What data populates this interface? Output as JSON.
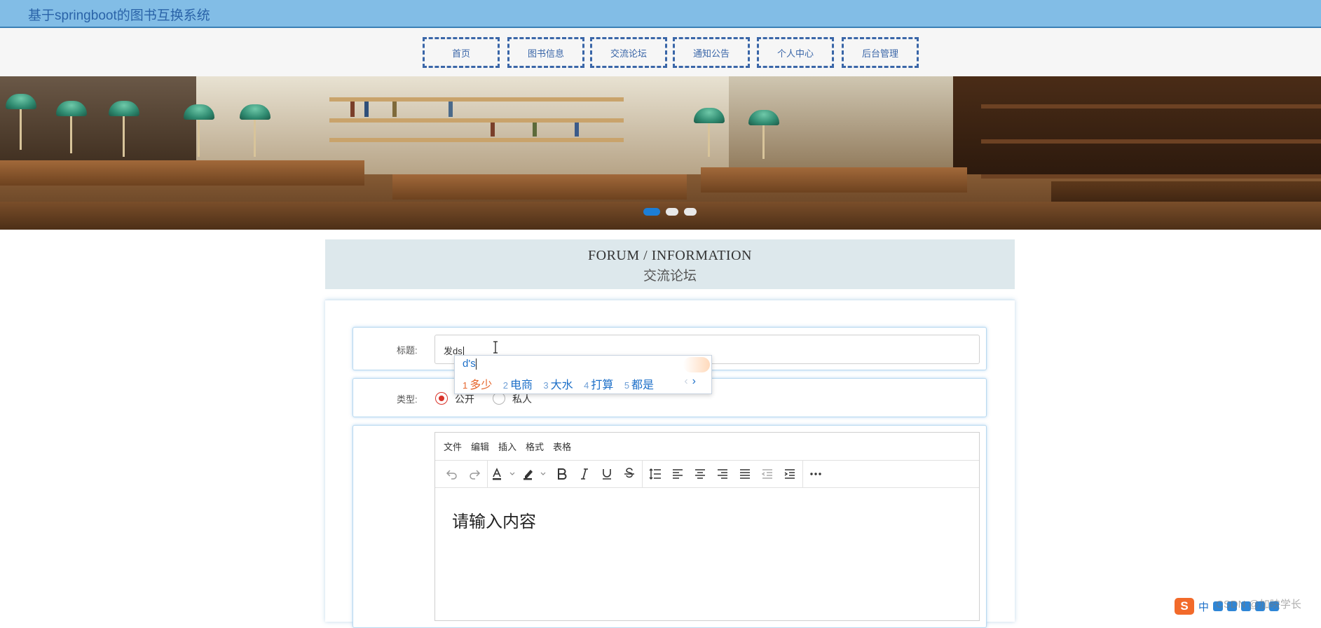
{
  "app": {
    "title": "基于springboot的图书互换系统"
  },
  "nav": {
    "items": [
      "首页",
      "图书信息",
      "交流论坛",
      "通知公告",
      "个人中心",
      "后台管理"
    ]
  },
  "banner": {
    "slides": 3,
    "active_slide": 1
  },
  "forum": {
    "title_en": "FORUM / INFORMATION",
    "title_zh": "交流论坛"
  },
  "form": {
    "title_label": "标题:",
    "title_value": "发ds",
    "type_label": "类型:",
    "type_options": [
      "公开",
      "私人"
    ],
    "type_selected": "公开"
  },
  "ime": {
    "composition": "d's",
    "candidates": [
      {
        "num": "1",
        "text": "多少"
      },
      {
        "num": "2",
        "text": "电商"
      },
      {
        "num": "3",
        "text": "大水"
      },
      {
        "num": "4",
        "text": "打算"
      },
      {
        "num": "5",
        "text": "都是"
      }
    ],
    "prev_arrow": "‹",
    "next_arrow": "›"
  },
  "editor": {
    "menus": [
      "文件",
      "编辑",
      "插入",
      "格式",
      "表格"
    ],
    "toolbar_icons": [
      "undo-icon",
      "redo-icon",
      "font-color-icon",
      "highlight-icon",
      "bold-icon",
      "italic-icon",
      "underline-icon",
      "strikethrough-icon",
      "line-height-icon",
      "align-left-icon",
      "align-center-icon",
      "align-right-icon",
      "align-justify-icon",
      "outdent-icon",
      "indent-icon",
      "more-icon"
    ],
    "placeholder": "请输入内容"
  },
  "taskbar": {
    "sogou_label": "中",
    "watermark": "CSDN @加映学长"
  },
  "colors": {
    "topbar": "#82bde6",
    "nav_border": "#3a66a8",
    "accent": "#1c7ed6",
    "radio": "#d9342b"
  }
}
